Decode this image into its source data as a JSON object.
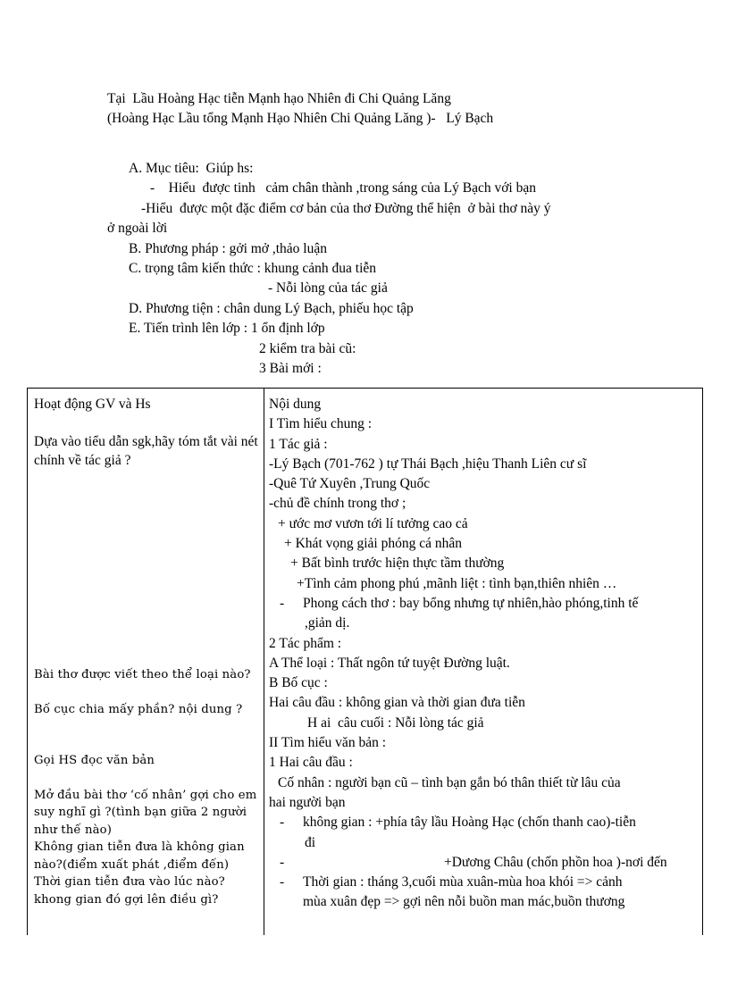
{
  "document": {
    "title_line_1": "Tại  Lầu Hoàng Hạc tiễn Mạnh hạo Nhiên đi Chi Quảng Lăng",
    "title_line_2": "(Hoàng Hạc Lầu tổng Mạnh Hạo Nhiên Chi Quảng Lăng )-   Lý Bạch",
    "objectives": {
      "a_label": "A. Mục tiêu:  Giúp hs:",
      "a_item_1": "-    Hiểu  được tinh   cảm chân thành ,trong sáng của Lý Bạch với bạn",
      "a_item_2": "-Hiểu  được một đặc điểm cơ bản của thơ Đường thể hiện  ở bài thơ này ý",
      "a_item_2_cont": "ở ngoài lời",
      "b_label": "B. Phương pháp : gởi mở ,thảo luận",
      "c_label": "C. trọng tâm kiến thức : khung cảnh đua tiễn",
      "c_sub": "- Nỗi lòng của tác giả",
      "d_label": "D. Phương tiện : chân dung Lý Bạch, phiếu học tập",
      "e_label": "E. Tiến trình lên lớp : 1 ổn định lớp",
      "e_sub_2": "2 kiểm tra bài cũ:",
      "e_sub_3": "3 Bài mới :"
    }
  },
  "table": {
    "col_left_header": "Hoạt động GV và Hs",
    "col_right_header": "Nội dung",
    "left_column": {
      "q1": "Dựa vào tiểu dẫn sgk,hãy tóm tắt vài nét chính về tác giả ?",
      "q2": "Bài thơ được viết theo thể loại nào?",
      "q3": "Bố cục chia mấy phần? nội dung ?",
      "q4": "Gọi  HS đọc văn bản",
      "q5": "Mở đầu bài thơ ‘cố nhân’ gợi cho em suy nghĩ gì ?(tình  bạn giữa 2 người như thế nào)",
      "q6": "Không gian tiễn đưa là không gian nào?(điểm  xuất phát ,điểm đến)",
      "q7": "Thời gian tiễn đưa vào lúc nào?khong gian đó gợi lên điều gì?"
    },
    "right_column": {
      "l01": "I Tìm hiểu chung :",
      "l02": "1 Tác giả :",
      "l03": "-Lý Bạch (701-762 ) tự Thái Bạch ,hiệu Thanh Liên cư sĩ",
      "l04": "-Quê Tứ Xuyên ,Trung Quốc",
      "l05": "-chủ đề chính trong thơ ;",
      "l06": "+ ước mơ vươn tới lí tưởng cao cả",
      "l07": "+ Khát vọng giải phóng cá nhân",
      "l08": "+ Bất bình trước hiện thực tầm thường",
      "l09": "+Tình cảm phong phú ,mãnh liệt  :  tình bạn,thiên nhiên …",
      "l10_dash": "-",
      "l10": "Phong cách thơ : bay bổng nhưng tự nhiên,hào phóng,tinh tế",
      "l11": ",giản dị.",
      "l12": "2 Tác phẩm :",
      "l13": "A Thể loại : Thất ngôn tứ tuyệt Đường luật.",
      "l14": "B Bố cục :",
      "l15": "Hai câu đầu : không gian và thời gian đưa tiễn",
      "l16": "H ai  câu cuối : Nỗi lòng tác giả",
      "l17": "II Tìm hiểu văn bản :",
      "l18": "1 Hai câu đầu :",
      "l19": "Cố nhân : người bạn cũ – tình bạn gắn bó thân thiết từ lâu của",
      "l20": "hai người bạn",
      "l21_dash": "-",
      "l21": "không gian : +phía tây lầu Hoàng Hạc (chốn thanh cao)-tiễn",
      "l22": "đi",
      "l23_dash": "-",
      "l23": "+Dương Châu  (chốn phồn hoa )-nơi đến",
      "l24_dash": "-",
      "l24": "Thời gian : tháng 3,cuối mùa xuân-mùa hoa khói => cảnh",
      "l25": "mùa xuân đẹp => gợi nên nỗi buồn man mác,buồn thương"
    }
  },
  "colors": {
    "text": "#000000",
    "page_background": "#ffffff",
    "table_border": "#000000"
  }
}
